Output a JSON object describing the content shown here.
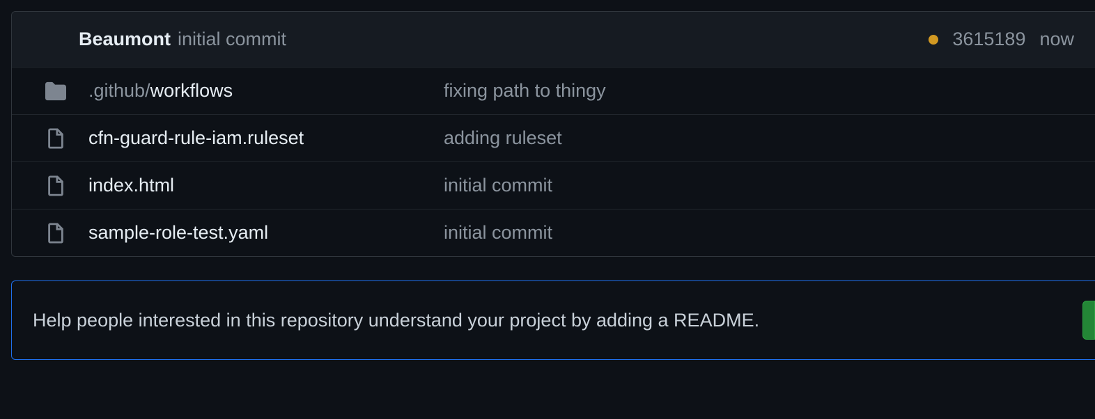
{
  "header": {
    "author": "Beaumont",
    "commit_message": "initial commit",
    "sha": "3615189",
    "time": "now"
  },
  "files": [
    {
      "type": "dir",
      "prefix": ".github/",
      "name": "workflows",
      "message": "fixing path to thingy"
    },
    {
      "type": "file",
      "prefix": "",
      "name": "cfn-guard-rule-iam.ruleset",
      "message": "adding ruleset"
    },
    {
      "type": "file",
      "prefix": "",
      "name": "index.html",
      "message": "initial commit"
    },
    {
      "type": "file",
      "prefix": "",
      "name": "sample-role-test.yaml",
      "message": "initial commit"
    }
  ],
  "readme_banner": {
    "text": "Help people interested in this repository understand your project by adding a README."
  }
}
